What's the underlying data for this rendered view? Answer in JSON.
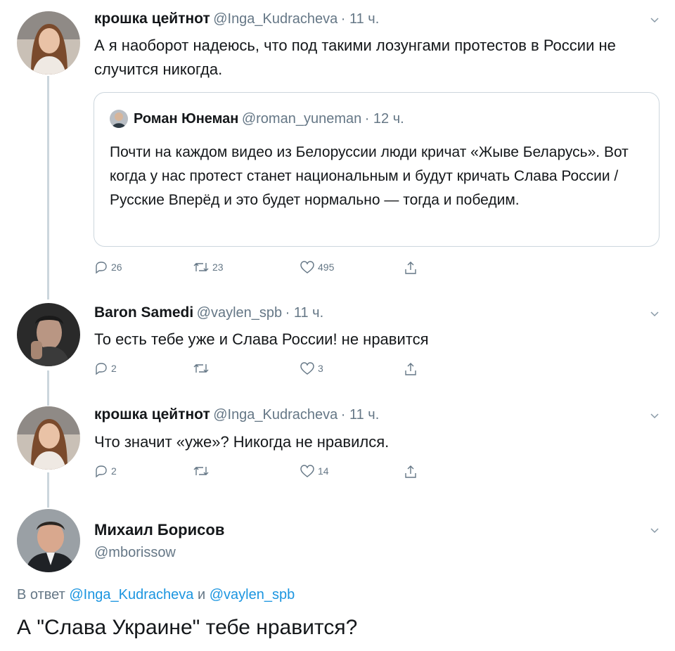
{
  "tweets": [
    {
      "author": "крошка цейтнот",
      "handle": "@Inga_Kudracheva",
      "time": "· 11 ч.",
      "text": "А я наоборот надеюсь, что под такими лозунгами протестов в России не случится никогда.",
      "quote": {
        "author": "Роман Юнеман",
        "handle": "@roman_yuneman",
        "time": "· 12 ч.",
        "text": "Почти на каждом видео из Белоруссии люди кричат «Жыве Беларусь». Вот когда у нас протест станет национальным и будут кричать Слава России / Русские Вперёд и это будет нормально — тогда и победим."
      },
      "replies": "26",
      "retweets": "23",
      "likes": "495"
    },
    {
      "author": "Baron Samedi",
      "handle": "@vaylen_spb",
      "time": "· 11 ч.",
      "text": "То есть тебе уже и Слава России! не нравится",
      "replies": "2",
      "retweets": "",
      "likes": "3"
    },
    {
      "author": "крошка цейтнот",
      "handle": "@Inga_Kudracheva",
      "time": "· 11 ч.",
      "text": "Что значит «уже»? Никогда не нравился.",
      "replies": "2",
      "retweets": "",
      "likes": "14"
    }
  ],
  "main_tweet": {
    "author": "Михаил Борисов",
    "handle": "@mborissow",
    "reply_prefix": "В ответ",
    "reply_to_1": "@Inga_Kudracheva",
    "reply_and": "и",
    "reply_to_2": "@vaylen_spb",
    "text": "А \"Слава Украине\" тебе нравится?"
  },
  "icons": {
    "reply": "reply-icon",
    "retweet": "retweet-icon",
    "like": "heart-icon",
    "share": "share-icon",
    "more": "chevron-down-icon"
  },
  "colors": {
    "link": "#1b95e0",
    "secondary": "#657786",
    "border": "#ccd6dd"
  }
}
